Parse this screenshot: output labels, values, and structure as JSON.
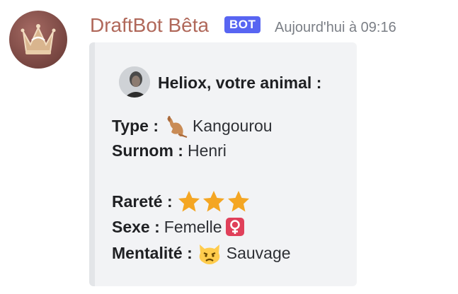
{
  "message": {
    "username": "DraftBot Bêta",
    "badge": "BOT",
    "timestamp": "Aujourd'hui à 09:16"
  },
  "embed": {
    "author": "Heliox, votre animal :",
    "fields": {
      "type_label": "Type :",
      "type_value": "Kangourou",
      "type_icon": "kangaroo-emoji",
      "surnom_label": "Surnom :",
      "surnom_value": "Henri",
      "rarete_label": "Rareté :",
      "rarete_stars": 3,
      "rarete_icon": "star-emoji",
      "sexe_label": "Sexe :",
      "sexe_value": "Femelle",
      "sexe_icon": "female-sign-emoji",
      "mentalite_label": "Mentalité :",
      "mentalite_value": "Sauvage",
      "mentalite_icon": "pouting-cat-emoji"
    }
  },
  "colors": {
    "username": "#b0685a",
    "badge": "#5865f2",
    "embed_background": "#f2f3f5",
    "embed_border": "#e3e5e8",
    "star": "#f4a623",
    "female_sign_bg": "#e0405a"
  }
}
